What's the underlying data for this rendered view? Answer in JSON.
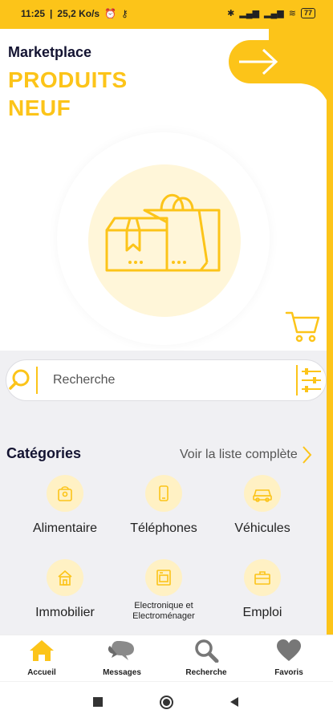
{
  "status": {
    "time": "11:25",
    "speed": "25,2 Ko/s",
    "battery": "77"
  },
  "header": {
    "label": "Marketplace",
    "title_line1": "PRODUITS",
    "title_line2": "NEUF"
  },
  "search": {
    "placeholder": "Recherche"
  },
  "categories": {
    "title": "Catégories",
    "see_all": "Voir la liste complète",
    "items": [
      {
        "label": "Alimentaire",
        "icon": "food-bag-icon"
      },
      {
        "label": "Téléphones",
        "icon": "phone-icon"
      },
      {
        "label": "Véhicules",
        "icon": "car-icon"
      },
      {
        "label": "Immobilier",
        "icon": "building-icon"
      },
      {
        "label": "Electronique et Electroménager",
        "icon": "appliance-icon"
      },
      {
        "label": "Emploi",
        "icon": "briefcase-icon"
      }
    ]
  },
  "bottom_nav": {
    "items": [
      {
        "label": "Accueil",
        "icon": "home-icon"
      },
      {
        "label": "Messages",
        "icon": "chat-icon"
      },
      {
        "label": "Recherche",
        "icon": "search-icon"
      },
      {
        "label": "Favoris",
        "icon": "heart-icon"
      }
    ]
  },
  "colors": {
    "accent": "#fcc419",
    "accent_light": "#fff6d9",
    "background_grey": "#f0f0f3",
    "title_dark": "#141432"
  }
}
